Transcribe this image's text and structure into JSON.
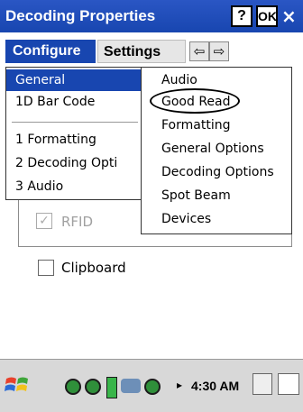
{
  "window": {
    "title": "Decoding Properties",
    "help_button": "?",
    "ok_button": "OK",
    "close_button": "×"
  },
  "tabs": [
    {
      "label": "Configure",
      "selected": true
    },
    {
      "label": "Settings",
      "selected": false
    }
  ],
  "tab_arrows": {
    "left": "⇦",
    "right": "⇨"
  },
  "main_menu": {
    "items": [
      {
        "label": "General",
        "selected": true
      },
      {
        "label": "1D Bar Code"
      },
      {
        "label": "1 Formatting"
      },
      {
        "label": "2 Decoding Opti"
      },
      {
        "label": "3 Audio"
      }
    ]
  },
  "sub_menu": {
    "items": [
      {
        "label": "Audio"
      },
      {
        "label": "Good Read",
        "circled": true
      },
      {
        "label": "Formatting"
      },
      {
        "label": "General Options"
      },
      {
        "label": "Decoding Options"
      },
      {
        "label": "Spot Beam"
      },
      {
        "label": "Devices"
      }
    ]
  },
  "options": {
    "rfid": {
      "label": "RFID",
      "checked": true,
      "enabled": false
    },
    "clipboard": {
      "label": "Clipboard",
      "checked": false
    }
  },
  "taskbar": {
    "clock": "4:30 AM",
    "tray_expander": "▸"
  },
  "colors": {
    "title_bar": "#1846b0",
    "selection": "#1846b0",
    "taskbar": "#d8d8d8"
  }
}
